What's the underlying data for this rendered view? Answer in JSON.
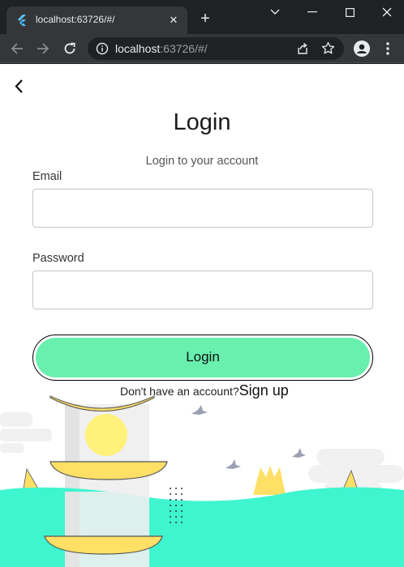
{
  "browser": {
    "tab_title": "localhost:63726/#/",
    "new_tab": "+",
    "url_host": "localhost",
    "url_rest": ":63726/#/"
  },
  "login_page": {
    "title": "Login",
    "subtitle": "Login to your account",
    "email_label": "Email",
    "email_value": "",
    "password_label": "Password",
    "password_value": "",
    "login_button": "Login",
    "signup_prompt": "Don't have an account?",
    "signup_link": "Sign up"
  },
  "colors": {
    "button_fill": "#69f0ae",
    "hill": "#3ef5d0",
    "lamp_yellow": "#ffe066"
  }
}
